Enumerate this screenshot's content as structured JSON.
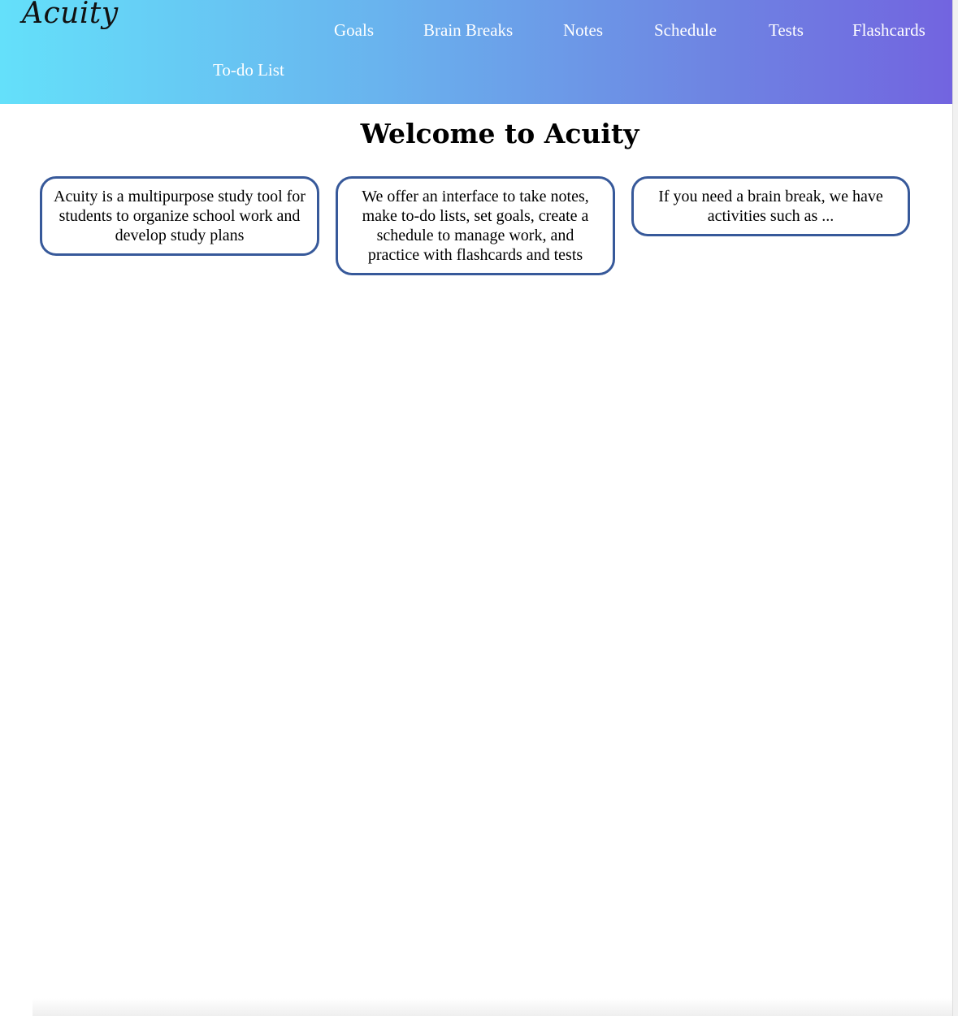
{
  "header": {
    "logo": "Acuity",
    "nav": {
      "goals": "Goals",
      "brain_breaks": "Brain Breaks",
      "notes": "Notes",
      "schedule": "Schedule",
      "tests": "Tests",
      "flashcards": "Flashcards",
      "todo": "To-do List"
    }
  },
  "main": {
    "title": "Welcome to Acuity",
    "cards": [
      {
        "text": "Acuity is a multipurpose study tool for students to organize school work and develop study plans"
      },
      {
        "text": "We offer an interface to take notes, make to-do lists, set goals, create a schedule to manage work, and practice with flashcards and tests"
      },
      {
        "text": "If you need a brain break, we have activities such as ..."
      }
    ]
  },
  "colors": {
    "header_gradient_start": "#64e0fa",
    "header_gradient_end": "#7264e0",
    "card_border": "#37599a"
  }
}
